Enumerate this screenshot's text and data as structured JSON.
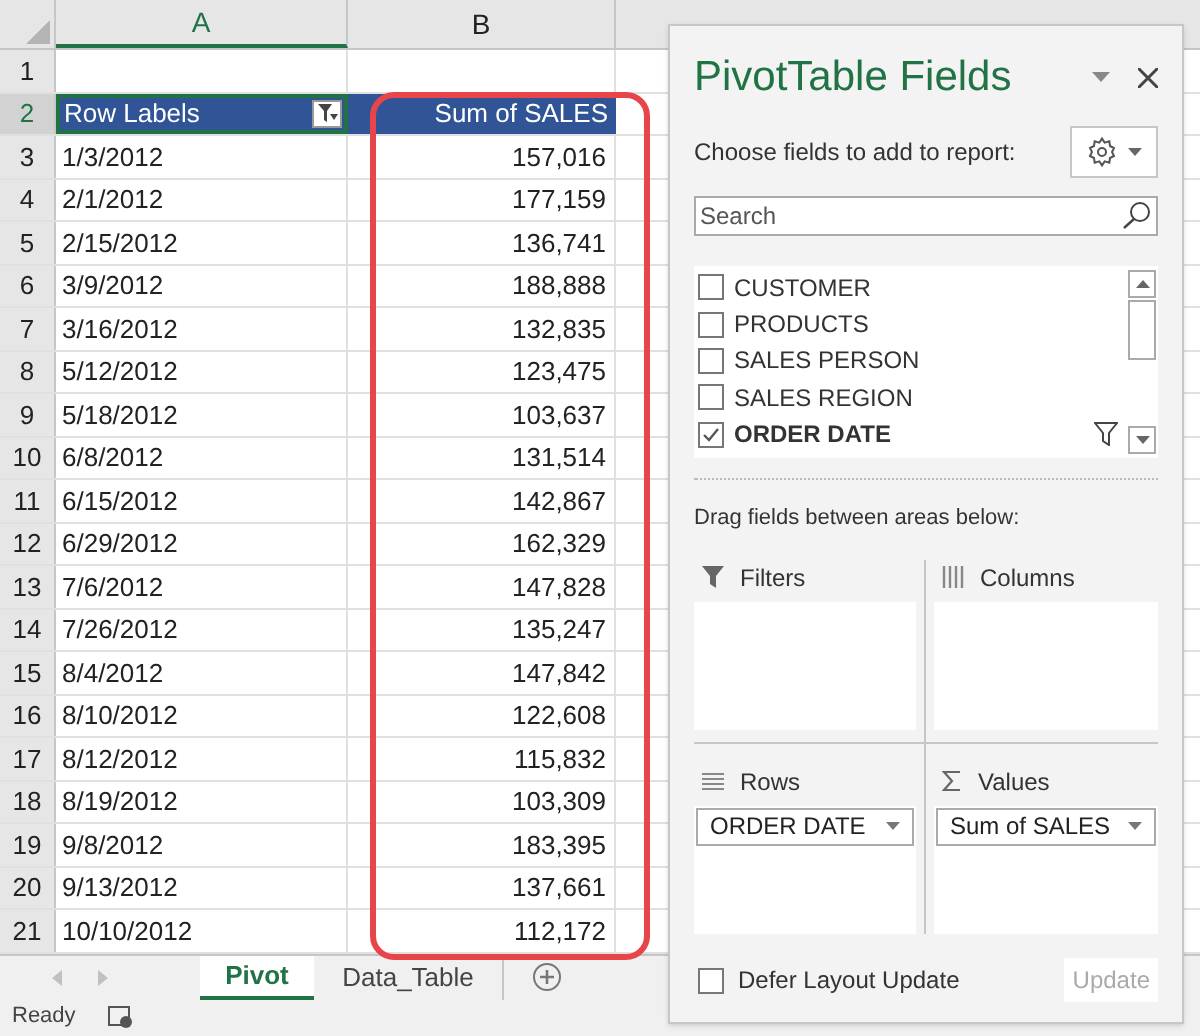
{
  "sheet": {
    "columns": [
      "A",
      "B"
    ],
    "header_row": {
      "number": "2",
      "row_label": "Row Labels",
      "value_label": "Sum of SALES"
    },
    "rows": [
      {
        "number": "3",
        "date": "1/3/2012",
        "sales": "157,016"
      },
      {
        "number": "4",
        "date": "2/1/2012",
        "sales": "177,159"
      },
      {
        "number": "5",
        "date": "2/15/2012",
        "sales": "136,741"
      },
      {
        "number": "6",
        "date": "3/9/2012",
        "sales": "188,888"
      },
      {
        "number": "7",
        "date": "3/16/2012",
        "sales": "132,835"
      },
      {
        "number": "8",
        "date": "5/12/2012",
        "sales": "123,475"
      },
      {
        "number": "9",
        "date": "5/18/2012",
        "sales": "103,637"
      },
      {
        "number": "10",
        "date": "6/8/2012",
        "sales": "131,514"
      },
      {
        "number": "11",
        "date": "6/15/2012",
        "sales": "142,867"
      },
      {
        "number": "12",
        "date": "6/29/2012",
        "sales": "162,329"
      },
      {
        "number": "13",
        "date": "7/6/2012",
        "sales": "147,828"
      },
      {
        "number": "14",
        "date": "7/26/2012",
        "sales": "135,247"
      },
      {
        "number": "15",
        "date": "8/4/2012",
        "sales": "147,842"
      },
      {
        "number": "16",
        "date": "8/10/2012",
        "sales": "122,608"
      },
      {
        "number": "17",
        "date": "8/12/2012",
        "sales": "115,832"
      },
      {
        "number": "18",
        "date": "8/19/2012",
        "sales": "103,309"
      },
      {
        "number": "19",
        "date": "9/8/2012",
        "sales": "183,395"
      },
      {
        "number": "20",
        "date": "9/13/2012",
        "sales": "137,661"
      },
      {
        "number": "21",
        "date": "10/10/2012",
        "sales": "112,172"
      }
    ],
    "first_row_number": "1"
  },
  "sheet_tabs": [
    {
      "label": "Pivot",
      "selected": true
    },
    {
      "label": "Data_Table",
      "selected": false
    }
  ],
  "status_bar": {
    "text": "Ready"
  },
  "panel": {
    "title": "PivotTable Fields",
    "subtitle": "Choose fields to add to report:",
    "search": {
      "placeholder": "Search"
    },
    "fields": [
      {
        "label": "CUSTOMER",
        "checked": false
      },
      {
        "label": "PRODUCTS",
        "checked": false
      },
      {
        "label": "SALES PERSON",
        "checked": false
      },
      {
        "label": "SALES REGION",
        "checked": false
      },
      {
        "label": "ORDER DATE",
        "checked": true
      }
    ],
    "areas_hint": "Drag fields between areas below:",
    "areas": [
      {
        "kind": "filters",
        "label": "Filters"
      },
      {
        "kind": "columns",
        "label": "Columns"
      },
      {
        "kind": "rows",
        "label": "Rows",
        "items": [
          "ORDER DATE"
        ]
      },
      {
        "kind": "values",
        "label": "Values",
        "items": [
          "Sum of SALES"
        ]
      }
    ],
    "defer": {
      "label": "Defer Layout Update",
      "checked": false
    },
    "update_button": {
      "label": "Update",
      "disabled": true
    }
  }
}
